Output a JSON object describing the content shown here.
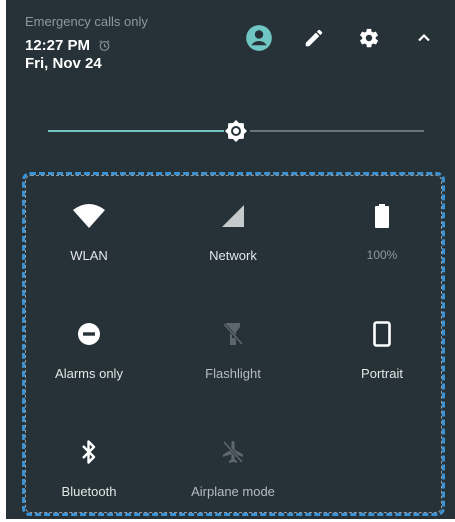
{
  "header": {
    "status_text": "Emergency calls only",
    "time": "12:27 PM",
    "date": "Fri, Nov 24",
    "icons": [
      "account-icon",
      "edit-icon",
      "settings-icon",
      "collapse-icon"
    ]
  },
  "brightness": {
    "level": 0.5
  },
  "tiles": [
    {
      "label": "WLAN",
      "icon": "wifi-icon",
      "state": "on"
    },
    {
      "label": "Network",
      "icon": "signal-icon",
      "state": "on"
    },
    {
      "label": "100%",
      "icon": "battery-icon",
      "state": "faint"
    },
    {
      "label": "Alarms only",
      "icon": "do-not-disturb-icon",
      "state": "on"
    },
    {
      "label": "Flashlight",
      "icon": "flashlight-icon",
      "state": "off"
    },
    {
      "label": "Portrait",
      "icon": "portrait-icon",
      "state": "on"
    },
    {
      "label": "Bluetooth",
      "icon": "bluetooth-icon",
      "state": "on"
    },
    {
      "label": "Airplane mode",
      "icon": "airplane-icon",
      "state": "off"
    }
  ],
  "colors": {
    "panel_bg": "#263238",
    "accent": "#6fc6c3",
    "selection_outline": "#3b93d6"
  }
}
